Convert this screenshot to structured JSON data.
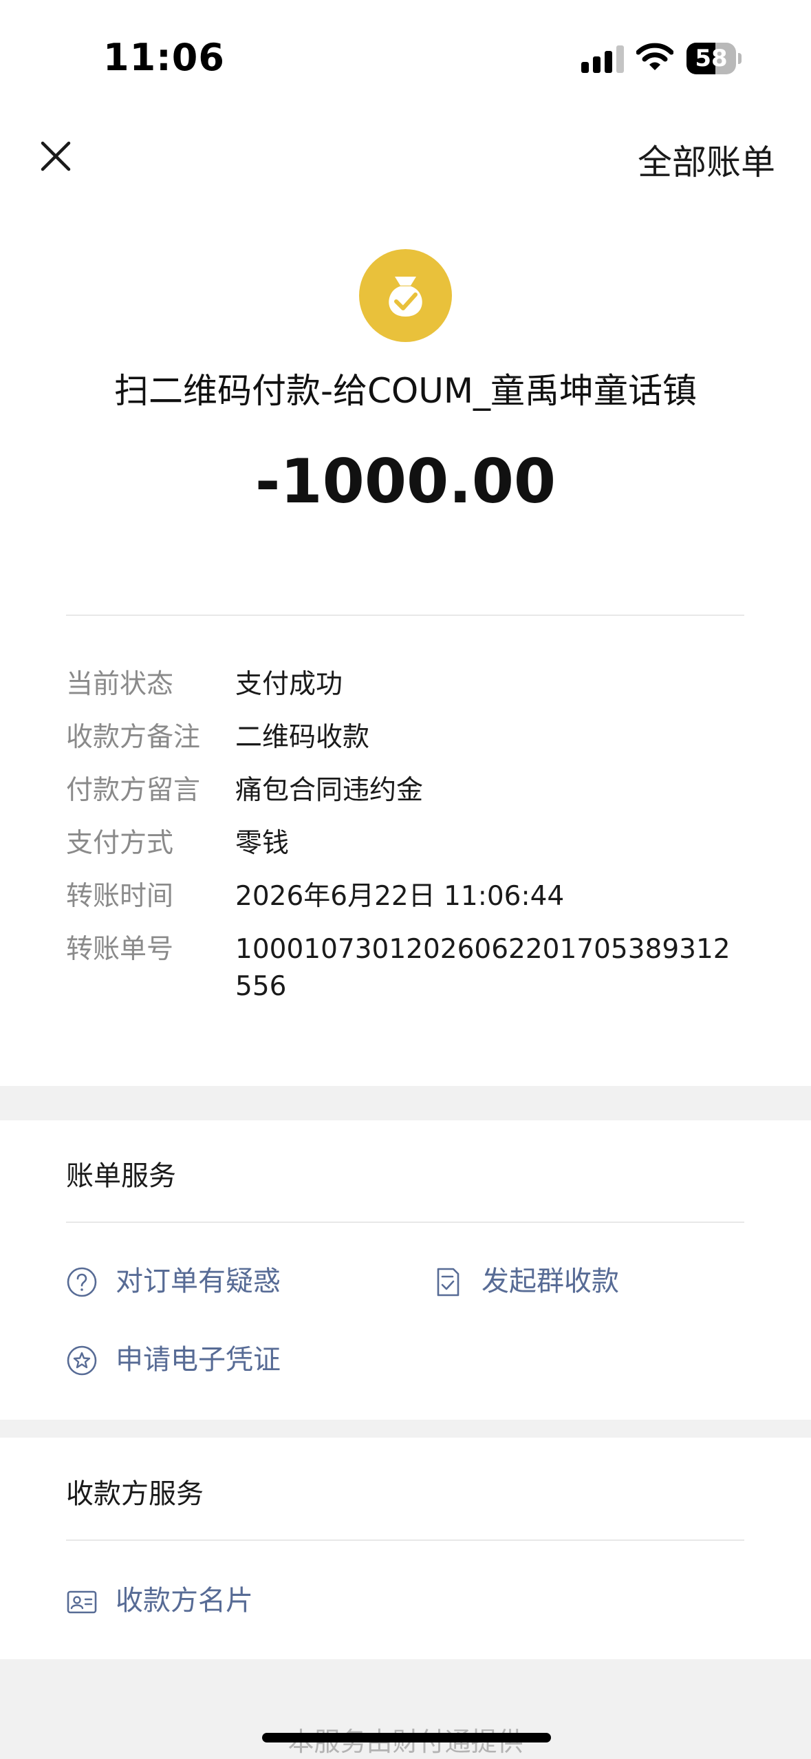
{
  "status_bar": {
    "time": "11:06",
    "battery": "58",
    "battery_fraction": 0.58
  },
  "nav": {
    "close_icon": "close-icon",
    "all_bills": "全部账单"
  },
  "header": {
    "logo_icon": "money-bag-check-icon",
    "logo_color": "#e9c13b",
    "title": "扫二维码付款-给COUM_童禹坤童话镇",
    "amount": "-1000.00"
  },
  "details": [
    {
      "label": "当前状态",
      "value": "支付成功"
    },
    {
      "label": "收款方备注",
      "value": "二维码收款"
    },
    {
      "label": "付款方留言",
      "value": "痛包合同违约金"
    },
    {
      "label": "支付方式",
      "value": "零钱"
    },
    {
      "label": "转账时间",
      "value": "2026年6月22日 11:06:44"
    },
    {
      "label": "转账单号",
      "value": "10001073012026062201705389312556"
    }
  ],
  "bill_services": {
    "title": "账单服务",
    "items": [
      {
        "icon": "question-circle-icon",
        "label": "对订单有疑惑"
      },
      {
        "icon": "group-receipt-icon",
        "label": "发起群收款"
      },
      {
        "icon": "star-circle-icon",
        "label": "申请电子凭证"
      }
    ]
  },
  "payee_services": {
    "title": "收款方服务",
    "items": [
      {
        "icon": "business-card-icon",
        "label": "收款方名片"
      }
    ]
  },
  "footer": {
    "text": "本服务由财付通提供"
  },
  "colors": {
    "link": "#576b95",
    "label": "#8a8a8a",
    "band": "#f1f1f1"
  }
}
